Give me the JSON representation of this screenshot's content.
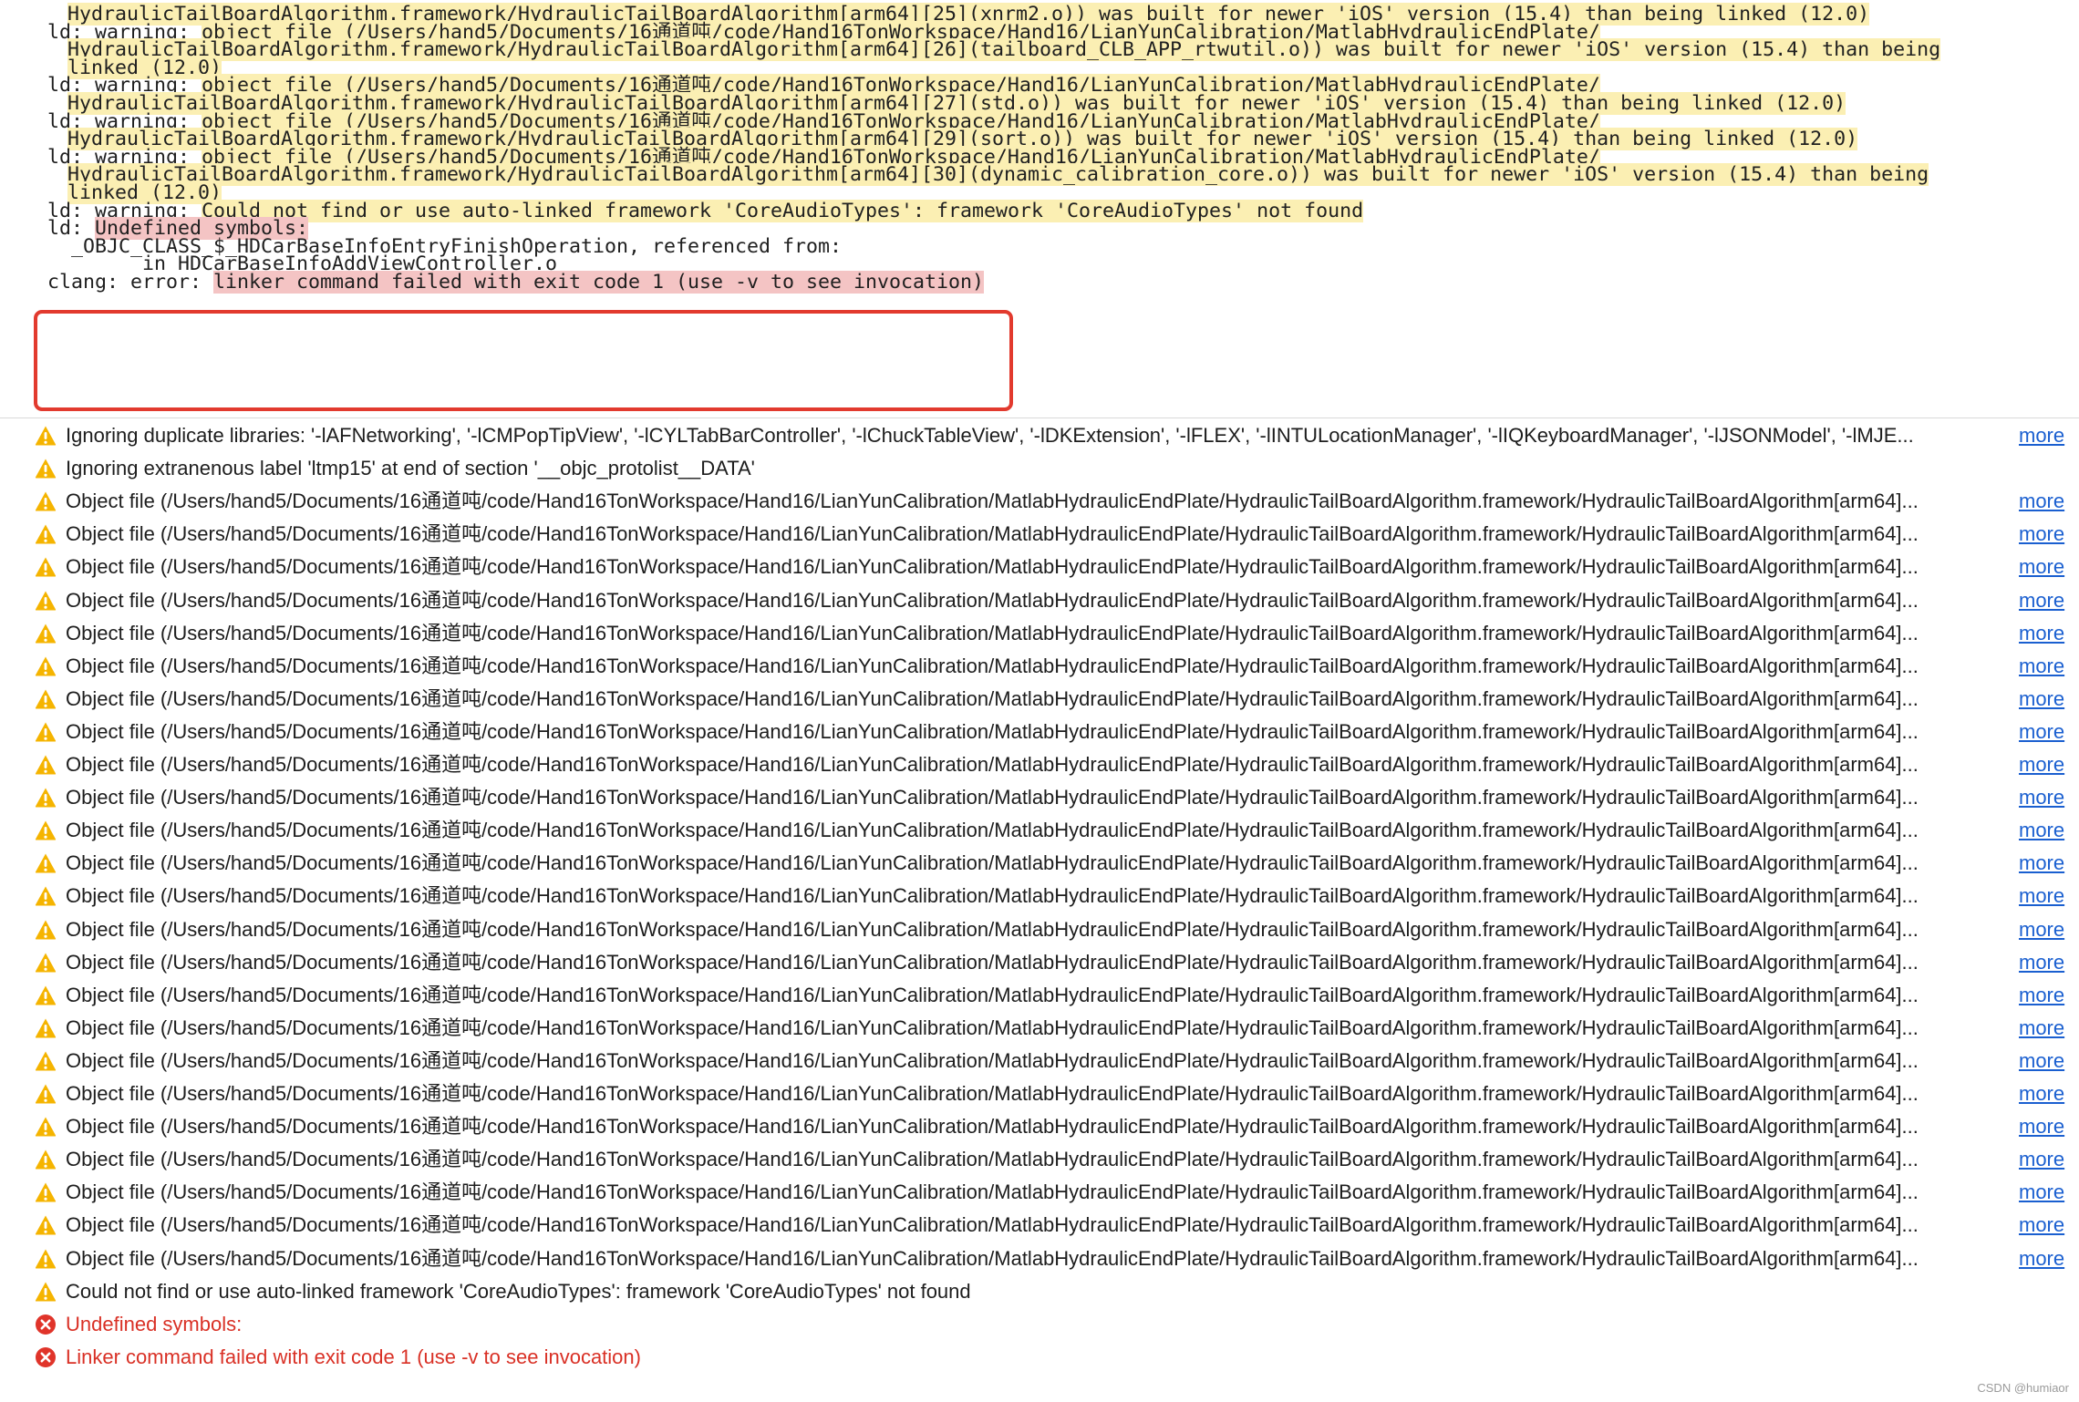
{
  "log": {
    "lines": [
      {
        "pre": "",
        "hl": "HydraulicTailBoardAlgorithm.framework/HydraulicTailBoardAlgorithm[arm64][25](xnrm2.o)) was built for newer 'iOS' version (15.4) than being linked (12.0)",
        "style": "warn"
      },
      {
        "pre": "ld: warning: ",
        "hl": "object file (/Users/hand5/Documents/16通道吨/code/Hand16TonWorkspace/Hand16/LianYunCalibration/MatlabHydraulicEndPlate/",
        "style": "warn"
      },
      {
        "pre": "",
        "hl": "HydraulicTailBoardAlgorithm.framework/HydraulicTailBoardAlgorithm[arm64][26](tailboard_CLB_APP_rtwutil.o)) was built for newer 'iOS' version (15.4) than being",
        "style": "warn"
      },
      {
        "pre": "",
        "hl": "linked (12.0)",
        "style": "warn"
      },
      {
        "pre": "ld: warning: ",
        "hl": "object file (/Users/hand5/Documents/16通道吨/code/Hand16TonWorkspace/Hand16/LianYunCalibration/MatlabHydraulicEndPlate/",
        "style": "warn"
      },
      {
        "pre": "",
        "hl": "HydraulicTailBoardAlgorithm.framework/HydraulicTailBoardAlgorithm[arm64][27](std.o)) was built for newer 'iOS' version (15.4) than being linked (12.0)",
        "style": "warn"
      },
      {
        "pre": "ld: warning: ",
        "hl": "object file (/Users/hand5/Documents/16通道吨/code/Hand16TonWorkspace/Hand16/LianYunCalibration/MatlabHydraulicEndPlate/",
        "style": "warn"
      },
      {
        "pre": "",
        "hl": "HydraulicTailBoardAlgorithm.framework/HydraulicTailBoardAlgorithm[arm64][29](sort.o)) was built for newer 'iOS' version (15.4) than being linked (12.0)",
        "style": "warn"
      },
      {
        "pre": "ld: warning: ",
        "hl": "object file (/Users/hand5/Documents/16通道吨/code/Hand16TonWorkspace/Hand16/LianYunCalibration/MatlabHydraulicEndPlate/",
        "style": "warn"
      },
      {
        "pre": "",
        "hl": "HydraulicTailBoardAlgorithm.framework/HydraulicTailBoardAlgorithm[arm64][30](dynamic_calibration_core.o)) was built for newer 'iOS' version (15.4) than being",
        "style": "warn"
      },
      {
        "pre": "",
        "hl": "linked (12.0)",
        "style": "warn"
      },
      {
        "pre": "ld: warning: ",
        "hl": "Could not find or use auto-linked framework 'CoreAudioTypes': framework 'CoreAudioTypes' not found",
        "style": "warn"
      },
      {
        "pre": "ld: ",
        "hl": "Undefined symbols:",
        "style": "error"
      },
      {
        "pre": "  _OBJC_CLASS_$_HDCarBaseInfoEntryFinishOperation, referenced from:",
        "hl": "",
        "style": "plain"
      },
      {
        "pre": "        in HDCarBaseInfoAddViewController.o",
        "hl": "",
        "style": "plain"
      },
      {
        "pre": "clang: error: ",
        "hl": "linker command failed with exit code 1 (use -v to see invocation)",
        "style": "error"
      }
    ]
  },
  "issues": {
    "more_label": "more",
    "object_file_message": "Object file (/Users/hand5/Documents/16通道吨/code/Hand16TonWorkspace/Hand16/LianYunCalibration/MatlabHydraulicEndPlate/HydraulicTailBoardAlgorithm.framework/HydraulicTailBoardAlgorithm[arm64]...",
    "items": [
      {
        "kind": "warning",
        "text": "Ignoring duplicate libraries: '-lAFNetworking', '-lCMPopTipView', '-lCYLTabBarController', '-lChuckTableView', '-lDKExtension', '-lFLEX', '-lINTULocationManager', '-lIQKeyboardManager', '-lJSONModel', '-lMJE...",
        "more": true
      },
      {
        "kind": "warning",
        "text": "Ignoring extranenous label 'ltmp15' at end of section '__objc_protolist__DATA'",
        "more": false
      },
      {
        "kind": "warning",
        "text": "Object file (/Users/hand5/Documents/16通道吨/code/Hand16TonWorkspace/Hand16/LianYunCalibration/MatlabHydraulicEndPlate/HydraulicTailBoardAlgorithm.framework/HydraulicTailBoardAlgorithm[arm64]...",
        "more": true
      },
      {
        "kind": "warning",
        "text": "Object file (/Users/hand5/Documents/16通道吨/code/Hand16TonWorkspace/Hand16/LianYunCalibration/MatlabHydraulicEndPlate/HydraulicTailBoardAlgorithm.framework/HydraulicTailBoardAlgorithm[arm64]...",
        "more": true
      },
      {
        "kind": "warning",
        "text": "Object file (/Users/hand5/Documents/16通道吨/code/Hand16TonWorkspace/Hand16/LianYunCalibration/MatlabHydraulicEndPlate/HydraulicTailBoardAlgorithm.framework/HydraulicTailBoardAlgorithm[arm64]...",
        "more": true
      },
      {
        "kind": "warning",
        "text": "Object file (/Users/hand5/Documents/16通道吨/code/Hand16TonWorkspace/Hand16/LianYunCalibration/MatlabHydraulicEndPlate/HydraulicTailBoardAlgorithm.framework/HydraulicTailBoardAlgorithm[arm64]...",
        "more": true
      },
      {
        "kind": "warning",
        "text": "Object file (/Users/hand5/Documents/16通道吨/code/Hand16TonWorkspace/Hand16/LianYunCalibration/MatlabHydraulicEndPlate/HydraulicTailBoardAlgorithm.framework/HydraulicTailBoardAlgorithm[arm64]...",
        "more": true
      },
      {
        "kind": "warning",
        "text": "Object file (/Users/hand5/Documents/16通道吨/code/Hand16TonWorkspace/Hand16/LianYunCalibration/MatlabHydraulicEndPlate/HydraulicTailBoardAlgorithm.framework/HydraulicTailBoardAlgorithm[arm64]...",
        "more": true
      },
      {
        "kind": "warning",
        "text": "Object file (/Users/hand5/Documents/16通道吨/code/Hand16TonWorkspace/Hand16/LianYunCalibration/MatlabHydraulicEndPlate/HydraulicTailBoardAlgorithm.framework/HydraulicTailBoardAlgorithm[arm64]...",
        "more": true
      },
      {
        "kind": "warning",
        "text": "Object file (/Users/hand5/Documents/16通道吨/code/Hand16TonWorkspace/Hand16/LianYunCalibration/MatlabHydraulicEndPlate/HydraulicTailBoardAlgorithm.framework/HydraulicTailBoardAlgorithm[arm64]...",
        "more": true
      },
      {
        "kind": "warning",
        "text": "Object file (/Users/hand5/Documents/16通道吨/code/Hand16TonWorkspace/Hand16/LianYunCalibration/MatlabHydraulicEndPlate/HydraulicTailBoardAlgorithm.framework/HydraulicTailBoardAlgorithm[arm64]...",
        "more": true
      },
      {
        "kind": "warning",
        "text": "Object file (/Users/hand5/Documents/16通道吨/code/Hand16TonWorkspace/Hand16/LianYunCalibration/MatlabHydraulicEndPlate/HydraulicTailBoardAlgorithm.framework/HydraulicTailBoardAlgorithm[arm64]...",
        "more": true
      },
      {
        "kind": "warning",
        "text": "Object file (/Users/hand5/Documents/16通道吨/code/Hand16TonWorkspace/Hand16/LianYunCalibration/MatlabHydraulicEndPlate/HydraulicTailBoardAlgorithm.framework/HydraulicTailBoardAlgorithm[arm64]...",
        "more": true
      },
      {
        "kind": "warning",
        "text": "Object file (/Users/hand5/Documents/16通道吨/code/Hand16TonWorkspace/Hand16/LianYunCalibration/MatlabHydraulicEndPlate/HydraulicTailBoardAlgorithm.framework/HydraulicTailBoardAlgorithm[arm64]...",
        "more": true
      },
      {
        "kind": "warning",
        "text": "Object file (/Users/hand5/Documents/16通道吨/code/Hand16TonWorkspace/Hand16/LianYunCalibration/MatlabHydraulicEndPlate/HydraulicTailBoardAlgorithm.framework/HydraulicTailBoardAlgorithm[arm64]...",
        "more": true
      },
      {
        "kind": "warning",
        "text": "Object file (/Users/hand5/Documents/16通道吨/code/Hand16TonWorkspace/Hand16/LianYunCalibration/MatlabHydraulicEndPlate/HydraulicTailBoardAlgorithm.framework/HydraulicTailBoardAlgorithm[arm64]...",
        "more": true
      },
      {
        "kind": "warning",
        "text": "Object file (/Users/hand5/Documents/16通道吨/code/Hand16TonWorkspace/Hand16/LianYunCalibration/MatlabHydraulicEndPlate/HydraulicTailBoardAlgorithm.framework/HydraulicTailBoardAlgorithm[arm64]...",
        "more": true
      },
      {
        "kind": "warning",
        "text": "Object file (/Users/hand5/Documents/16通道吨/code/Hand16TonWorkspace/Hand16/LianYunCalibration/MatlabHydraulicEndPlate/HydraulicTailBoardAlgorithm.framework/HydraulicTailBoardAlgorithm[arm64]...",
        "more": true
      },
      {
        "kind": "warning",
        "text": "Object file (/Users/hand5/Documents/16通道吨/code/Hand16TonWorkspace/Hand16/LianYunCalibration/MatlabHydraulicEndPlate/HydraulicTailBoardAlgorithm.framework/HydraulicTailBoardAlgorithm[arm64]...",
        "more": true
      },
      {
        "kind": "warning",
        "text": "Object file (/Users/hand5/Documents/16通道吨/code/Hand16TonWorkspace/Hand16/LianYunCalibration/MatlabHydraulicEndPlate/HydraulicTailBoardAlgorithm.framework/HydraulicTailBoardAlgorithm[arm64]...",
        "more": true
      },
      {
        "kind": "warning",
        "text": "Object file (/Users/hand5/Documents/16通道吨/code/Hand16TonWorkspace/Hand16/LianYunCalibration/MatlabHydraulicEndPlate/HydraulicTailBoardAlgorithm.framework/HydraulicTailBoardAlgorithm[arm64]...",
        "more": true
      },
      {
        "kind": "warning",
        "text": "Object file (/Users/hand5/Documents/16通道吨/code/Hand16TonWorkspace/Hand16/LianYunCalibration/MatlabHydraulicEndPlate/HydraulicTailBoardAlgorithm.framework/HydraulicTailBoardAlgorithm[arm64]...",
        "more": true
      },
      {
        "kind": "warning",
        "text": "Object file (/Users/hand5/Documents/16通道吨/code/Hand16TonWorkspace/Hand16/LianYunCalibration/MatlabHydraulicEndPlate/HydraulicTailBoardAlgorithm.framework/HydraulicTailBoardAlgorithm[arm64]...",
        "more": true
      },
      {
        "kind": "warning",
        "text": "Object file (/Users/hand5/Documents/16通道吨/code/Hand16TonWorkspace/Hand16/LianYunCalibration/MatlabHydraulicEndPlate/HydraulicTailBoardAlgorithm.framework/HydraulicTailBoardAlgorithm[arm64]...",
        "more": true
      },
      {
        "kind": "warning",
        "text": "Object file (/Users/hand5/Documents/16通道吨/code/Hand16TonWorkspace/Hand16/LianYunCalibration/MatlabHydraulicEndPlate/HydraulicTailBoardAlgorithm.framework/HydraulicTailBoardAlgorithm[arm64]...",
        "more": true
      },
      {
        "kind": "warning",
        "text": "Object file (/Users/hand5/Documents/16通道吨/code/Hand16TonWorkspace/Hand16/LianYunCalibration/MatlabHydraulicEndPlate/HydraulicTailBoardAlgorithm.framework/HydraulicTailBoardAlgorithm[arm64]...",
        "more": true
      },
      {
        "kind": "warning",
        "text": "Could not find or use auto-linked framework 'CoreAudioTypes': framework 'CoreAudioTypes' not found",
        "more": false
      },
      {
        "kind": "error",
        "text": "Undefined symbols:",
        "more": false
      },
      {
        "kind": "error",
        "text": "Linker command failed with exit code 1 (use -v to see invocation)",
        "more": false
      }
    ]
  },
  "watermark": "CSDN @humiaor",
  "colors": {
    "warning_highlight": "#fbefb3",
    "error_highlight": "#f4c4c4",
    "error_box": "#e23a2e",
    "warning_icon": "#f5b400",
    "error_icon": "#e0342a",
    "error_text": "#d93025",
    "link": "#1a5fd0"
  },
  "icons": {
    "warning": "warning-triangle-icon",
    "error": "error-x-circle-icon"
  }
}
